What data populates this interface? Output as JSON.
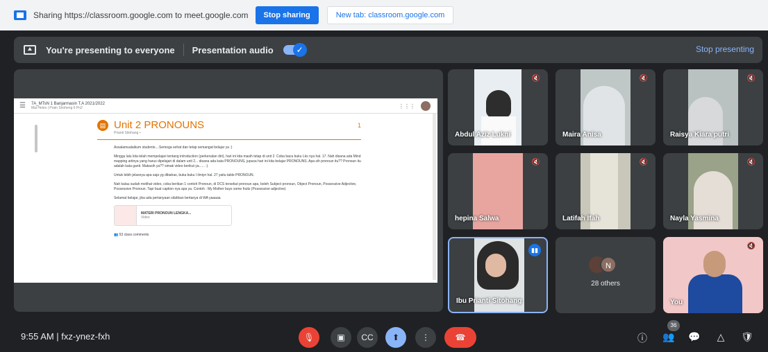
{
  "sharing_bar": {
    "text": "Sharing https://classroom.google.com to meet.google.com",
    "stop_label": "Stop sharing",
    "new_tab_label": "New tab: classroom.google.com"
  },
  "presenting_bar": {
    "text": "You're presenting to everyone",
    "audio_label": "Presentation audio",
    "audio_on": true,
    "stop_label": "Stop presenting"
  },
  "presentation": {
    "class_name": "7A_MTsN 1 Banjarmasin T.A 2021/2022",
    "class_sub": "Mai Heles | Prain Siroheng 6 Pn2",
    "unit_title": "Unit 2 PRONOUNS",
    "unit_number": "1",
    "author": "Prianti Sitohang •",
    "paragraphs": [
      "Assalamualaikum students....Semoga sehat dan tetap semangat belajar ya :)",
      "Minggu lalu kita telah mempelajari tentang introduction (perkenalan diri), hari ini kita masih tetap di unit 2. Coba baca buku Lks nya hal. 17. Nah disana ada Mind mapping artinya yang harus dipelajari di dalam unit 2... disana ada kata PRONOUNS, jupusa hari ini kita belajar PRONOUNS. Apa sih pronoun itu?? Pronoun itu adalah kata ganti. Makasih ya?? simak video berikut ya...... :)",
      "Untuk lebih jelasnya apa saja yg dibahas, buka buku l ilmiyn hal. 27 yaitu table PRONOUN.",
      "Nah kalau sudah melihat video, coba berikan 1 contoh Pronoun, di DCS tersebut pronoun apa, boleh Subject pronoun, Object Pronoun, Possessive Adjective, Possessive Pronoun. Tapi buat caption nya apa ya. Contoh : My Mother buys some fruits (Possessive adjective)",
      "Selamat belajar, jika ada pertanyaan silahkan bertanya di WA yaaaaa"
    ],
    "attachment_title": "MATERI PRONOUN LENGKA...",
    "attachment_type": "Video",
    "comments": "53 class comments"
  },
  "participants": [
    {
      "name": "Abdul Aziz Lukni"
    },
    {
      "name": "Maira Anisa"
    },
    {
      "name": "Raisya Kiara putri"
    },
    {
      "name": "hepina Salwa"
    },
    {
      "name": "Latifah Ifah"
    },
    {
      "name": "Nayla Yasmina"
    },
    {
      "name": "Ibu Prianti Sitohang"
    },
    {
      "name": "28 others",
      "initial": "N"
    },
    {
      "name": "You"
    }
  ],
  "bottom_bar": {
    "meeting_info": "9:55 AM | fxz-ynez-fxh",
    "people_count": "36"
  },
  "colors": {
    "accent": "#1a73e8",
    "hangup": "#ea4335",
    "background": "#202124",
    "tile": "#3c4043"
  }
}
